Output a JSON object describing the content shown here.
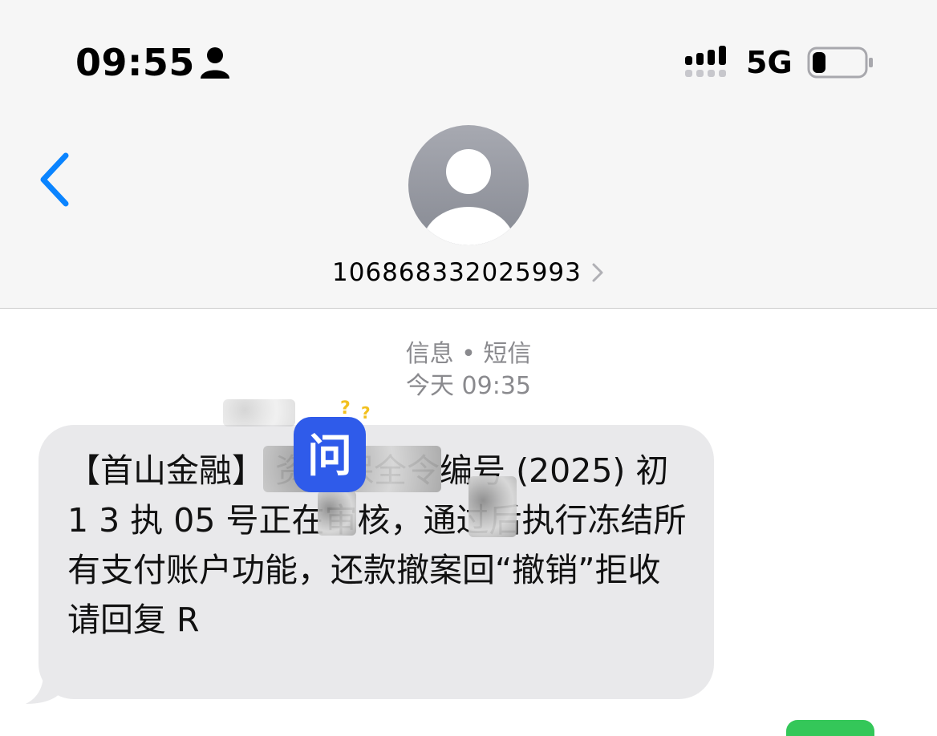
{
  "status_bar": {
    "time": "09:55",
    "person_icon": "person-icon",
    "signal_icon": "cellular-signal-icon",
    "network": "5G",
    "battery_icon": "battery-icon",
    "battery_level": 0.25
  },
  "header": {
    "back_icon": "chevron-left-icon",
    "avatar_icon": "contact-avatar-icon",
    "contact_name": "106868332025993",
    "contact_chevron_icon": "chevron-right-icon"
  },
  "conversation": {
    "service_label": "信息 • 短信",
    "timestamp": "今天 09:35"
  },
  "message": {
    "text": "【首山金融】 资产保全令编号 (2025) 初 1 3 执 05 号正在审核，通过后执行冻结所有支付账户功能，还款撤案回“撤销”拒收请回复 R",
    "sticker_label": "问"
  },
  "colors": {
    "accent": "#0a84ff",
    "bubble": "#e9e9eb",
    "meta": "#8a8a8e",
    "header_bg": "#f6f6f6",
    "avatar_bg": "#9ea0a8"
  }
}
